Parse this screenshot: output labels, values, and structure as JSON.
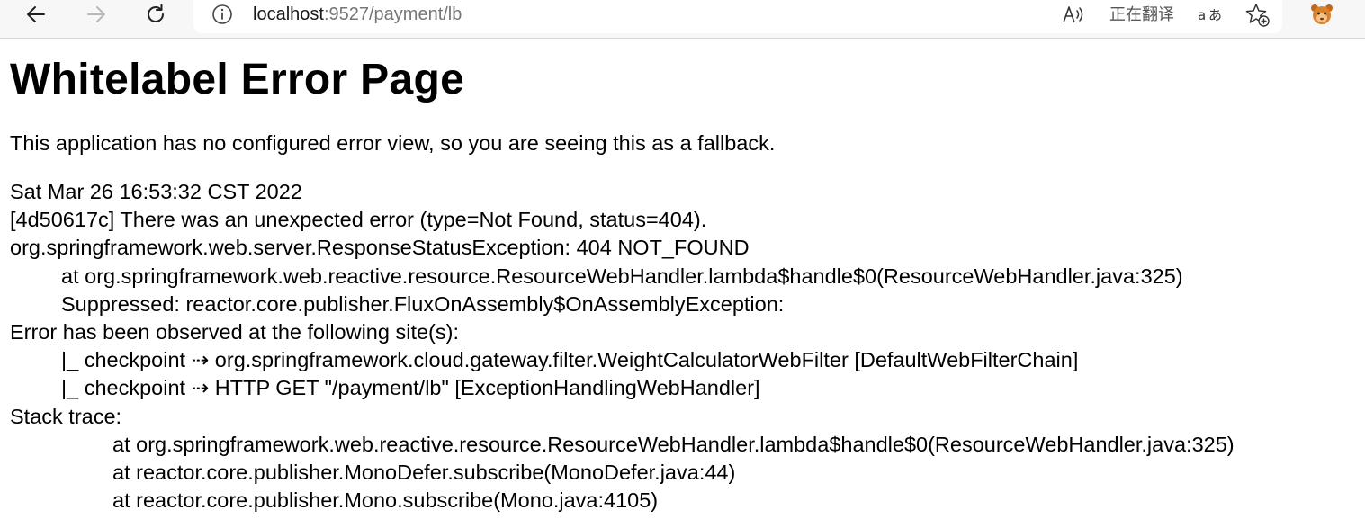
{
  "browser": {
    "url_host": "localhost",
    "url_rest": ":9527/payment/lb",
    "translate_status": "正在翻译",
    "icons": [
      "back-arrow-icon",
      "forward-arrow-icon",
      "refresh-icon",
      "site-info-icon",
      "read-aloud-icon",
      "translate-icon",
      "add-favorite-icon",
      "profile-icon"
    ]
  },
  "page": {
    "title": "Whitelabel Error Page",
    "fallback_message": "This application has no configured error view, so you are seeing this as a fallback.",
    "timestamp": "Sat Mar 26 16:53:32 CST 2022",
    "error_summary": "[4d50617c] There was an unexpected error (type=Not Found, status=404).",
    "exception": "org.springframework.web.server.ResponseStatusException: 404 NOT_FOUND",
    "exception_at": "at org.springframework.web.reactive.resource.ResourceWebHandler.lambda$handle$0(ResourceWebHandler.java:325)",
    "suppressed": "Suppressed: reactor.core.publisher.FluxOnAssembly$OnAssemblyException:",
    "observed_header": "Error has been observed at the following site(s):",
    "checkpoints": [
      "|_ checkpoint ⇢ org.springframework.cloud.gateway.filter.WeightCalculatorWebFilter [DefaultWebFilterChain]",
      "|_ checkpoint ⇢ HTTP GET \"/payment/lb\" [ExceptionHandlingWebHandler]"
    ],
    "stack_header": "Stack trace:",
    "stack_frames": [
      "at org.springframework.web.reactive.resource.ResourceWebHandler.lambda$handle$0(ResourceWebHandler.java:325)",
      "at reactor.core.publisher.MonoDefer.subscribe(MonoDefer.java:44)",
      "at reactor.core.publisher.Mono.subscribe(Mono.java:4105)"
    ]
  }
}
